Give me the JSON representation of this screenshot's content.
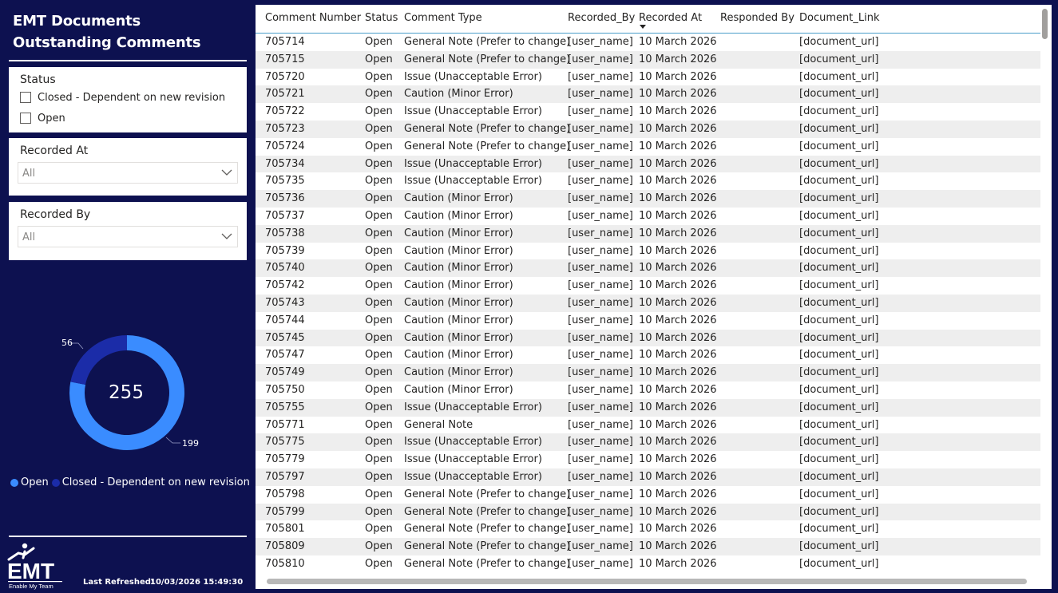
{
  "header": {
    "title_line1": "EMT Documents",
    "title_line2": "Outstanding Comments"
  },
  "status_slicer": {
    "title": "Status",
    "options": [
      {
        "label": "Closed - Dependent on new revision",
        "checked": false
      },
      {
        "label": "Open",
        "checked": false
      }
    ]
  },
  "recorded_at_slicer": {
    "title": "Recorded At",
    "value": "All"
  },
  "recorded_by_slicer": {
    "title": "Recorded By",
    "value": "All"
  },
  "donut": {
    "total": "255",
    "segments": [
      {
        "name": "Open",
        "value": 199,
        "label": "199",
        "color": "#3a8cff"
      },
      {
        "name": "Closed - Dependent on new revision",
        "value": 56,
        "label": "56",
        "color": "#1b2ca8"
      }
    ]
  },
  "legend": {
    "open": "Open",
    "closed": "Closed - Dependent on new revision"
  },
  "logo": {
    "text": "EMT",
    "tagline": "Enable My Team"
  },
  "footer": {
    "refresh_label": "Last Refreshed:",
    "refresh_value": "10/03/2026 15:49:30"
  },
  "table": {
    "columns": [
      "Comment Number",
      "Status",
      "Comment Type",
      "Recorded_By",
      "Recorded At",
      "Responded By",
      "Document_Link"
    ],
    "sorted_column": "Recorded At",
    "rows": [
      [
        "705714",
        "Open",
        "General Note (Prefer to change)",
        "[user_name]",
        "10 March 2026",
        "",
        "[document_url]"
      ],
      [
        "705715",
        "Open",
        "General Note (Prefer to change)",
        "[user_name]",
        "10 March 2026",
        "",
        "[document_url]"
      ],
      [
        "705720",
        "Open",
        "Issue (Unacceptable Error)",
        "[user_name]",
        "10 March 2026",
        "",
        "[document_url]"
      ],
      [
        "705721",
        "Open",
        "Caution (Minor Error)",
        "[user_name]",
        "10 March 2026",
        "",
        "[document_url]"
      ],
      [
        "705722",
        "Open",
        "Issue (Unacceptable Error)",
        "[user_name]",
        "10 March 2026",
        "",
        "[document_url]"
      ],
      [
        "705723",
        "Open",
        "General Note (Prefer to change)",
        "[user_name]",
        "10 March 2026",
        "",
        "[document_url]"
      ],
      [
        "705724",
        "Open",
        "General Note (Prefer to change)",
        "[user_name]",
        "10 March 2026",
        "",
        "[document_url]"
      ],
      [
        "705734",
        "Open",
        "Issue (Unacceptable Error)",
        "[user_name]",
        "10 March 2026",
        "",
        "[document_url]"
      ],
      [
        "705735",
        "Open",
        "Issue (Unacceptable Error)",
        "[user_name]",
        "10 March 2026",
        "",
        "[document_url]"
      ],
      [
        "705736",
        "Open",
        "Caution (Minor Error)",
        "[user_name]",
        "10 March 2026",
        "",
        "[document_url]"
      ],
      [
        "705737",
        "Open",
        "Caution (Minor Error)",
        "[user_name]",
        "10 March 2026",
        "",
        "[document_url]"
      ],
      [
        "705738",
        "Open",
        "Caution (Minor Error)",
        "[user_name]",
        "10 March 2026",
        "",
        "[document_url]"
      ],
      [
        "705739",
        "Open",
        "Caution (Minor Error)",
        "[user_name]",
        "10 March 2026",
        "",
        "[document_url]"
      ],
      [
        "705740",
        "Open",
        "Caution (Minor Error)",
        "[user_name]",
        "10 March 2026",
        "",
        "[document_url]"
      ],
      [
        "705742",
        "Open",
        "Caution (Minor Error)",
        "[user_name]",
        "10 March 2026",
        "",
        "[document_url]"
      ],
      [
        "705743",
        "Open",
        "Caution (Minor Error)",
        "[user_name]",
        "10 March 2026",
        "",
        "[document_url]"
      ],
      [
        "705744",
        "Open",
        "Caution (Minor Error)",
        "[user_name]",
        "10 March 2026",
        "",
        "[document_url]"
      ],
      [
        "705745",
        "Open",
        "Caution (Minor Error)",
        "[user_name]",
        "10 March 2026",
        "",
        "[document_url]"
      ],
      [
        "705747",
        "Open",
        "Caution (Minor Error)",
        "[user_name]",
        "10 March 2026",
        "",
        "[document_url]"
      ],
      [
        "705749",
        "Open",
        "Caution (Minor Error)",
        "[user_name]",
        "10 March 2026",
        "",
        "[document_url]"
      ],
      [
        "705750",
        "Open",
        "Caution (Minor Error)",
        "[user_name]",
        "10 March 2026",
        "",
        "[document_url]"
      ],
      [
        "705755",
        "Open",
        "Issue (Unacceptable Error)",
        "[user_name]",
        "10 March 2026",
        "",
        "[document_url]"
      ],
      [
        "705771",
        "Open",
        "General Note",
        "[user_name]",
        "10 March 2026",
        "",
        "[document_url]"
      ],
      [
        "705775",
        "Open",
        "Issue (Unacceptable Error)",
        "[user_name]",
        "10 March 2026",
        "",
        "[document_url]"
      ],
      [
        "705779",
        "Open",
        "Issue (Unacceptable Error)",
        "[user_name]",
        "10 March 2026",
        "",
        "[document_url]"
      ],
      [
        "705797",
        "Open",
        "Issue (Unacceptable Error)",
        "[user_name]",
        "10 March 2026",
        "",
        "[document_url]"
      ],
      [
        "705798",
        "Open",
        "General Note (Prefer to change)",
        "[user_name]",
        "10 March 2026",
        "",
        "[document_url]"
      ],
      [
        "705799",
        "Open",
        "General Note (Prefer to change)",
        "[user_name]",
        "10 March 2026",
        "",
        "[document_url]"
      ],
      [
        "705801",
        "Open",
        "General Note (Prefer to change)",
        "[user_name]",
        "10 March 2026",
        "",
        "[document_url]"
      ],
      [
        "705809",
        "Open",
        "General Note (Prefer to change)",
        "[user_name]",
        "10 March 2026",
        "",
        "[document_url]"
      ],
      [
        "705810",
        "Open",
        "General Note (Prefer to change)",
        "[user_name]",
        "10 March 2026",
        "",
        "[document_url]"
      ]
    ]
  }
}
